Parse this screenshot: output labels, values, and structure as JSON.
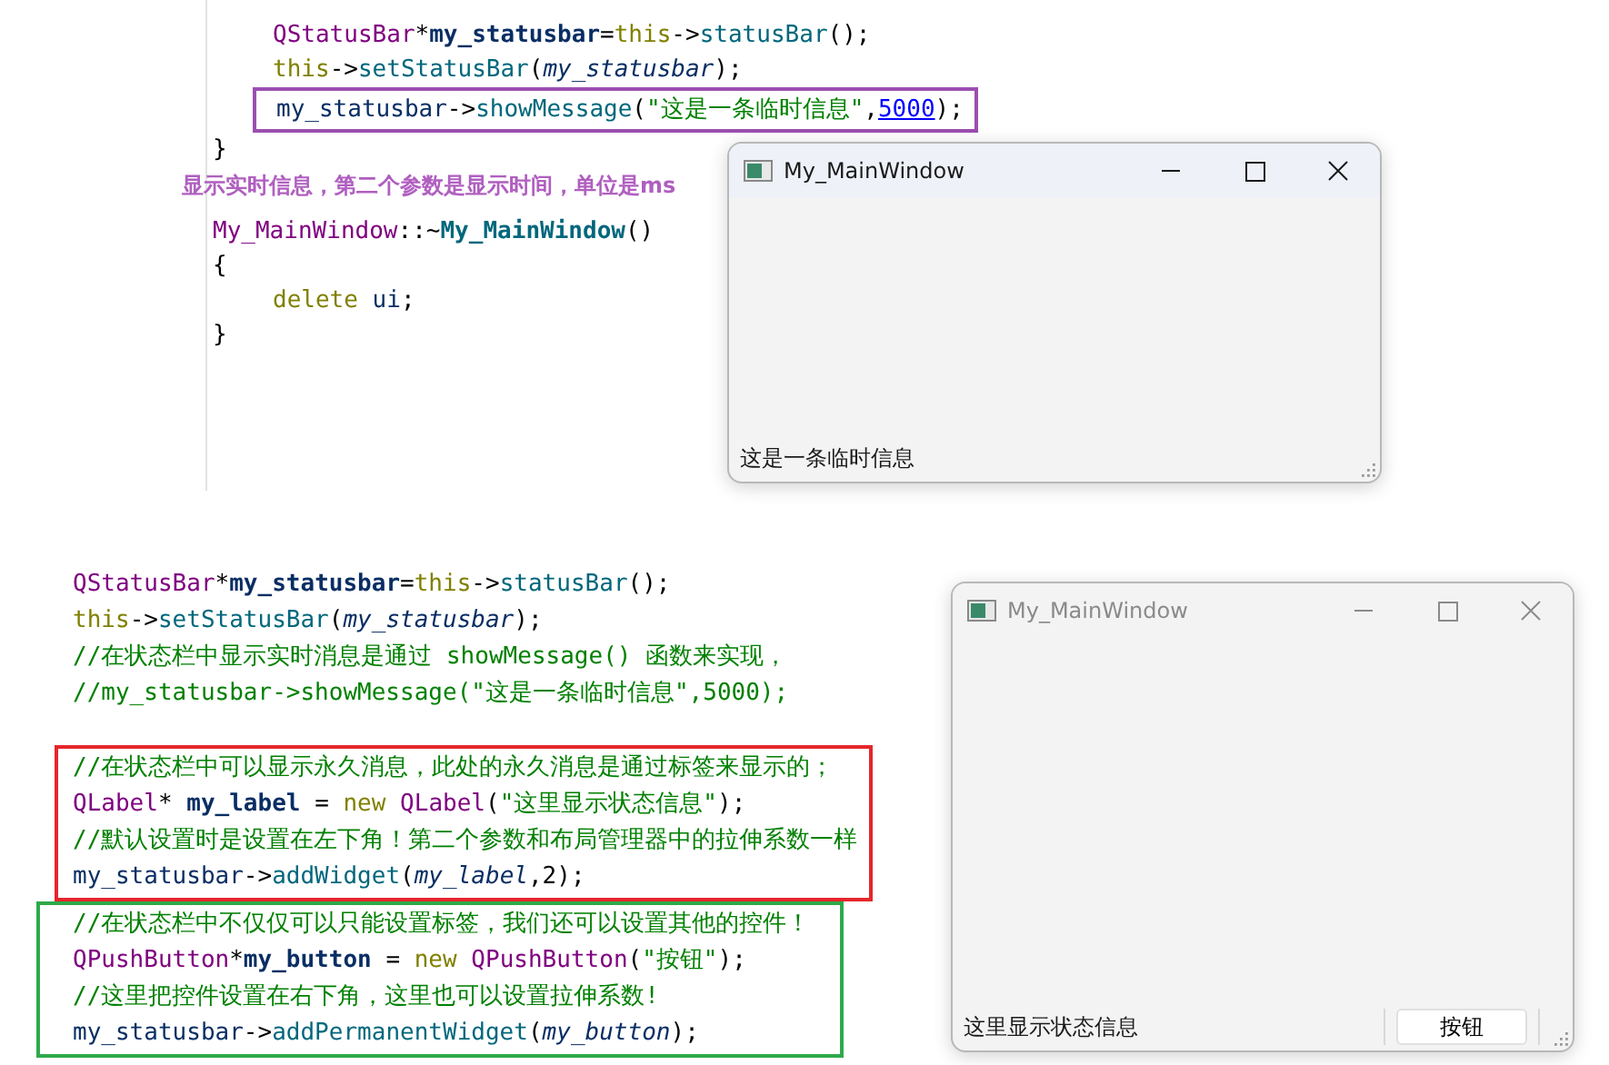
{
  "top_panel": {
    "blocks": [
      {
        "kind": "code",
        "lines": [
          {
            "indented": true,
            "tokens": [
              {
                "text": "QStatusBar",
                "kind": "type"
              },
              {
                "text": "*",
                "kind": "op"
              },
              {
                "text": "my_statusbar",
                "kind": "member"
              },
              {
                "text": "=",
                "kind": "op"
              },
              {
                "text": "this",
                "kind": "keyword"
              },
              {
                "text": "->",
                "kind": "op"
              },
              {
                "text": "statusBar",
                "kind": "func"
              },
              {
                "text": "();",
                "kind": "op"
              }
            ]
          },
          {
            "indented": true,
            "tokens": [
              {
                "text": "this",
                "kind": "keyword"
              },
              {
                "text": "->",
                "kind": "op"
              },
              {
                "text": "setStatusBar",
                "kind": "func"
              },
              {
                "text": "(",
                "kind": "op"
              },
              {
                "text": "my_statusbar",
                "kind": "param"
              },
              {
                "text": ");",
                "kind": "op"
              }
            ]
          }
        ]
      },
      {
        "kind": "code",
        "color": "#9b4fb0",
        "lines": [
          {
            "indented": true,
            "tokens": [
              {
                "text": "my_statusbar",
                "kind": "var"
              },
              {
                "text": "->",
                "kind": "op"
              },
              {
                "text": "showMessage",
                "kind": "func"
              },
              {
                "text": "(",
                "kind": "op"
              },
              {
                "text": "\"这是一条临时信息\"",
                "kind": "string"
              },
              {
                "text": ",",
                "kind": "op"
              },
              {
                "text": "5000",
                "kind": "number"
              },
              {
                "text": ");",
                "kind": "op"
              }
            ]
          }
        ]
      },
      {
        "kind": "code",
        "lines": [
          {
            "indented": false,
            "tokens": [
              {
                "text": "}",
                "kind": "op"
              }
            ]
          }
        ]
      },
      {
        "kind": "note",
        "text": "显示实时信息，第二个参数是显示时间，单位是ms"
      },
      {
        "kind": "code",
        "lines": [
          {
            "indented": false,
            "tokens": [
              {
                "text": "My_MainWindow",
                "kind": "type"
              },
              {
                "text": "::~",
                "kind": "op"
              },
              {
                "text": "My_MainWindow",
                "kind": "funcdef"
              },
              {
                "text": "()",
                "kind": "op"
              }
            ]
          },
          {
            "indented": false,
            "tokens": [
              {
                "text": "{",
                "kind": "op"
              }
            ]
          },
          {
            "indented": true,
            "tokens": [
              {
                "text": "delete",
                "kind": "keyword"
              },
              {
                "text": " ui",
                "kind": "var"
              },
              {
                "text": ";",
                "kind": "op"
              }
            ]
          },
          {
            "indented": false,
            "tokens": [
              {
                "text": "}",
                "kind": "op"
              }
            ]
          }
        ]
      }
    ],
    "window": {
      "title": "My_MainWindow",
      "active": true,
      "status_text": "这是一条临时信息"
    }
  },
  "bottom_panel": {
    "blocks": [
      {
        "kind": "code",
        "lines": [
          {
            "indented": false,
            "tokens": [
              {
                "text": "QStatusBar",
                "kind": "type"
              },
              {
                "text": "*",
                "kind": "op"
              },
              {
                "text": "my_statusbar",
                "kind": "member"
              },
              {
                "text": "=",
                "kind": "op"
              },
              {
                "text": "this",
                "kind": "keyword"
              },
              {
                "text": "->",
                "kind": "op"
              },
              {
                "text": "statusBar",
                "kind": "func"
              },
              {
                "text": "();",
                "kind": "op"
              }
            ]
          },
          {
            "indented": false,
            "tokens": [
              {
                "text": "this",
                "kind": "keyword"
              },
              {
                "text": "->",
                "kind": "op"
              },
              {
                "text": "setStatusBar",
                "kind": "func"
              },
              {
                "text": "(",
                "kind": "op"
              },
              {
                "text": "my_statusbar",
                "kind": "param"
              },
              {
                "text": ");",
                "kind": "op"
              }
            ]
          },
          {
            "indented": false,
            "tokens": [
              {
                "text": "//在状态栏中显示实时消息是通过 showMessage() 函数来实现，",
                "kind": "comment"
              }
            ]
          },
          {
            "indented": false,
            "tokens": [
              {
                "text": "//my_statusbar->showMessage(\"这是一条临时信息\",5000);",
                "kind": "comment"
              }
            ]
          }
        ]
      },
      {
        "kind": "code",
        "color": "#e5262b",
        "lines": [
          {
            "indented": false,
            "tokens": [
              {
                "text": "//在状态栏中可以显示永久消息，此处的永久消息是通过标签来显示的；",
                "kind": "comment"
              }
            ]
          },
          {
            "indented": false,
            "tokens": [
              {
                "text": "QLabel",
                "kind": "type"
              },
              {
                "text": "* ",
                "kind": "op"
              },
              {
                "text": "my_label",
                "kind": "member"
              },
              {
                "text": " = ",
                "kind": "op"
              },
              {
                "text": "new ",
                "kind": "keyword"
              },
              {
                "text": "QLabel",
                "kind": "type"
              },
              {
                "text": "(",
                "kind": "op"
              },
              {
                "text": "\"这里显示状态信息\"",
                "kind": "string"
              },
              {
                "text": ");",
                "kind": "op"
              }
            ]
          },
          {
            "indented": false,
            "tokens": [
              {
                "text": "//默认设置时是设置在左下角！第二个参数和布局管理器中的拉伸系数一样",
                "kind": "comment"
              }
            ]
          },
          {
            "indented": false,
            "tokens": [
              {
                "text": "my_statusbar",
                "kind": "var"
              },
              {
                "text": "->",
                "kind": "op"
              },
              {
                "text": "addWidget",
                "kind": "func"
              },
              {
                "text": "(",
                "kind": "op"
              },
              {
                "text": "my_label",
                "kind": "param"
              },
              {
                "text": ",2);",
                "kind": "op"
              }
            ]
          }
        ]
      },
      {
        "kind": "code",
        "color": "#2eaa4a",
        "lines": [
          {
            "indented": false,
            "tokens": [
              {
                "text": "//在状态栏中不仅仅可以只能设置标签，我们还可以设置其他的控件！",
                "kind": "comment"
              }
            ]
          },
          {
            "indented": false,
            "tokens": [
              {
                "text": "QPushButton",
                "kind": "type"
              },
              {
                "text": "*",
                "kind": "op"
              },
              {
                "text": "my_button",
                "kind": "member"
              },
              {
                "text": " = ",
                "kind": "op"
              },
              {
                "text": "new ",
                "kind": "keyword"
              },
              {
                "text": "QPushButton",
                "kind": "type"
              },
              {
                "text": "(",
                "kind": "op"
              },
              {
                "text": "\"按钮\"",
                "kind": "string"
              },
              {
                "text": ");",
                "kind": "op"
              }
            ]
          },
          {
            "indented": false,
            "tokens": [
              {
                "text": "//这里把控件设置在右下角，这里也可以设置拉伸系数!",
                "kind": "comment"
              }
            ]
          },
          {
            "indented": false,
            "tokens": [
              {
                "text": "my_statusbar",
                "kind": "var"
              },
              {
                "text": "->",
                "kind": "op"
              },
              {
                "text": "addPermanentWidget",
                "kind": "func"
              },
              {
                "text": "(",
                "kind": "op"
              },
              {
                "text": "my_button",
                "kind": "param"
              },
              {
                "text": ");",
                "kind": "op"
              }
            ]
          }
        ]
      }
    ],
    "window": {
      "title": "My_MainWindow",
      "active": false,
      "status_text": "这里显示状态信息",
      "status_button": "按钮"
    }
  }
}
